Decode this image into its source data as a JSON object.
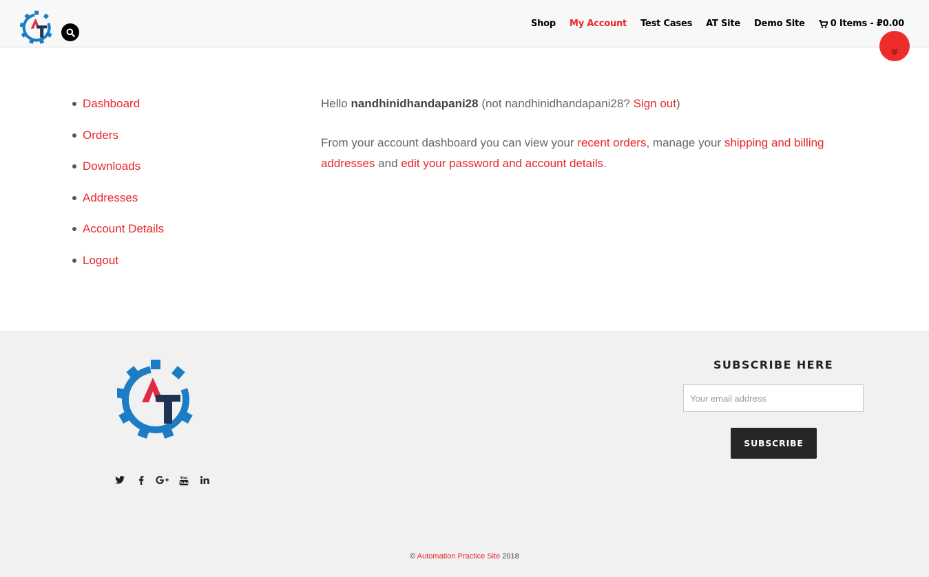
{
  "header": {
    "logo_icon": "at-gear-logo-icon",
    "search_icon": "search-icon",
    "nav": [
      {
        "label": "Shop"
      },
      {
        "label": "My Account"
      },
      {
        "label": "Test Cases"
      },
      {
        "label": "AT Site"
      },
      {
        "label": "Demo Site"
      }
    ],
    "cart": {
      "icon": "cart-icon",
      "label": "0 Items - ₽0.00"
    },
    "scroll_down_icon": "chevron-double-down-icon"
  },
  "sidebar": {
    "items": [
      {
        "label": "Dashboard"
      },
      {
        "label": "Orders"
      },
      {
        "label": "Downloads"
      },
      {
        "label": "Addresses"
      },
      {
        "label": "Account Details"
      },
      {
        "label": "Logout"
      }
    ]
  },
  "content": {
    "hello_prefix": "Hello ",
    "username": "nandhinidhandapani28",
    "not_prefix": " (not nandhinidhandapani28? ",
    "sign_out": "Sign out",
    "not_suffix": ")",
    "intro_1": "From your account dashboard you can view your ",
    "link_orders": "recent orders",
    "intro_2": ", manage your ",
    "link_addresses": "shipping and billing addresses",
    "intro_3": " and ",
    "link_account": "edit your password and account details",
    "intro_4": "."
  },
  "footer": {
    "social_icons": [
      "twitter-icon",
      "facebook-icon",
      "google-plus-icon",
      "youtube-icon",
      "linkedin-icon"
    ],
    "youtube_text": "You Tube",
    "subscribe_title": "SUBSCRIBE HERE",
    "email_placeholder": "Your email address",
    "subscribe_button": "SUBSCRIBE",
    "copyright_symbol": "© ",
    "copyright_link": "Automation Practice Site",
    "copyright_year": " 2018"
  },
  "colors": {
    "accent": "#e8262a",
    "header_bg": "#f8f8f8",
    "footer_bg": "#f1f1f1",
    "button_dark": "#262626",
    "logo_blue": "#1b7dc3",
    "logo_red": "#e02a45",
    "logo_navy": "#1d3550"
  }
}
